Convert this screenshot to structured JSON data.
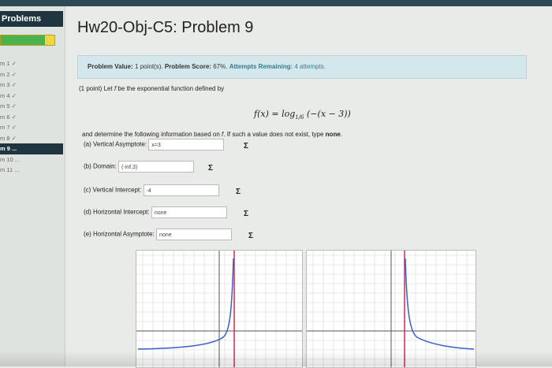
{
  "sidebar": {
    "header": "Problems",
    "progress": 0.82,
    "items": [
      "m 1 ✓",
      "m 2 ✓",
      "m 3 ✓",
      "m 4 ✓",
      "m 5 ✓",
      "m 6 ✓",
      "m 7 ✓",
      "m 8 ✓",
      "m 9 ...",
      "m 10 ...",
      "m 11 ..."
    ],
    "active_index": 8
  },
  "title": "Hw20-Obj-C5: Problem 9",
  "info": {
    "value_label": "Problem Value:",
    "value_text": "1 point(s).",
    "score_label": "Problem Score:",
    "score_text": "67%.",
    "attempts_label": "Attempts Remaining:",
    "attempts_text": "4 attempts."
  },
  "problem": {
    "intro_prefix": "(1 point) Let",
    "intro_var": "f",
    "intro_suffix": "be the exponential function defined by",
    "formula_lhs": "f(x) = log",
    "formula_base": "1/6",
    "formula_rhs": "(−(x − 3))",
    "determine_prefix": "and determine the following information based on",
    "determine_var": "f",
    "determine_suffix": ". If such a value does not exist, type",
    "determine_none": "none"
  },
  "questions": [
    {
      "label": "(a) Vertical Asymptote:",
      "value": "x=3"
    },
    {
      "label": "(b) Domain:",
      "value": "(-inf,3)"
    },
    {
      "label": "(c) Vertical Intercept:",
      "value": "-4"
    },
    {
      "label": "(d) Horizontal Intercept:",
      "value": "none"
    },
    {
      "label": "(e) Horizontal Asymptote:",
      "value": "none"
    }
  ],
  "colors": {
    "curve": "#3a5fcd",
    "asymptote": "#d03060",
    "accent": "#3a7a8a"
  }
}
